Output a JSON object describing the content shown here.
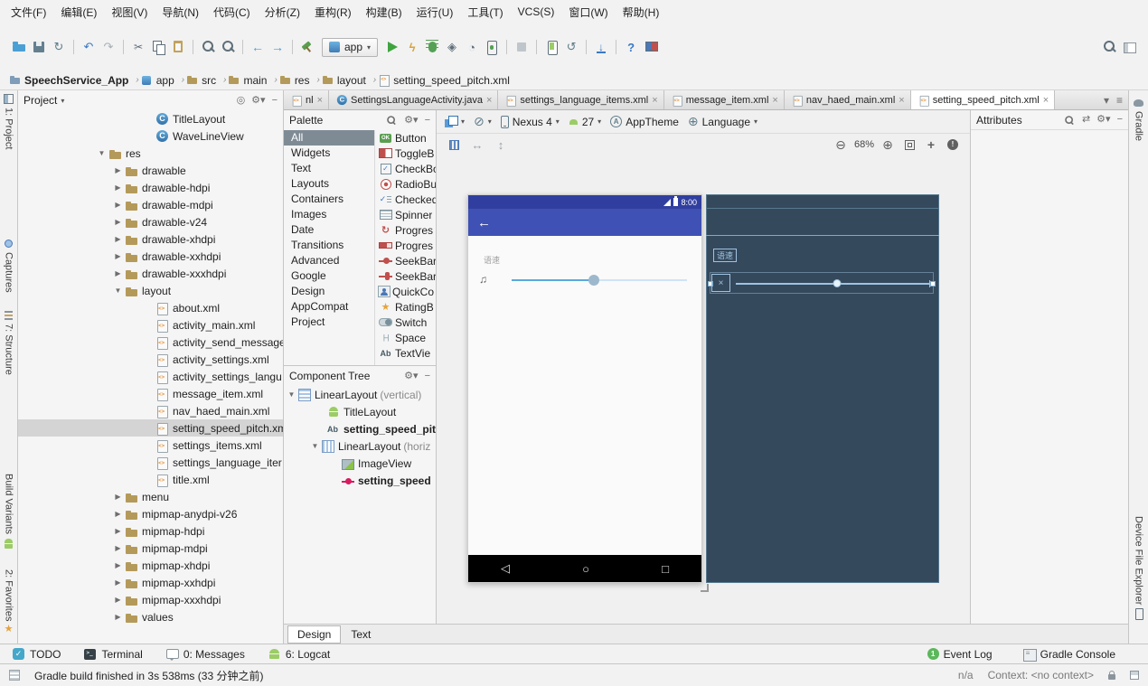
{
  "menu": {
    "items": [
      {
        "label": "文件(F)",
        "name": "menu-file"
      },
      {
        "label": "编辑(E)",
        "name": "menu-edit"
      },
      {
        "label": "视图(V)",
        "name": "menu-view"
      },
      {
        "label": "导航(N)",
        "name": "menu-navigate"
      },
      {
        "label": "代码(C)",
        "name": "menu-code"
      },
      {
        "label": "分析(Z)",
        "name": "menu-analyze"
      },
      {
        "label": "重构(R)",
        "name": "menu-refactor"
      },
      {
        "label": "构建(B)",
        "name": "menu-build"
      },
      {
        "label": "运行(U)",
        "name": "menu-run"
      },
      {
        "label": "工具(T)",
        "name": "menu-tools"
      },
      {
        "label": "VCS(S)",
        "name": "menu-vcs"
      },
      {
        "label": "窗口(W)",
        "name": "menu-window"
      },
      {
        "label": "帮助(H)",
        "name": "menu-help"
      }
    ]
  },
  "toolbar": {
    "run_config": "app",
    "icons_left": [
      {
        "name": "open"
      },
      {
        "name": "save"
      },
      {
        "name": "sync"
      },
      {
        "name": "sep"
      },
      {
        "name": "undo"
      },
      {
        "name": "redo"
      },
      {
        "name": "sep"
      },
      {
        "name": "cut"
      },
      {
        "name": "copy"
      },
      {
        "name": "paste"
      },
      {
        "name": "sep"
      },
      {
        "name": "find"
      },
      {
        "name": "replace"
      },
      {
        "name": "sep"
      },
      {
        "name": "nav-back"
      },
      {
        "name": "nav-forward"
      },
      {
        "name": "sep"
      },
      {
        "name": "build"
      }
    ],
    "icons_right": [
      {
        "name": "run"
      },
      {
        "name": "apply-changes"
      },
      {
        "name": "debug"
      },
      {
        "name": "coverage"
      },
      {
        "name": "profiler"
      },
      {
        "name": "attach-debugger"
      },
      {
        "name": "sep"
      },
      {
        "name": "stop"
      },
      {
        "name": "sep"
      },
      {
        "name": "avd-manager"
      },
      {
        "name": "gradle-sync"
      },
      {
        "name": "sep"
      },
      {
        "name": "sdk-manager"
      },
      {
        "name": "sep"
      },
      {
        "name": "help"
      },
      {
        "name": "monitor"
      }
    ],
    "icons_far": [
      {
        "name": "search-everywhere"
      },
      {
        "name": "panels"
      }
    ]
  },
  "breadcrumbs": [
    {
      "label": "SpeechService_App",
      "icon": "folder-root",
      "bold": "bold"
    },
    {
      "label": "app",
      "icon": "module"
    },
    {
      "label": "src",
      "icon": "folder"
    },
    {
      "label": "main",
      "icon": "folder"
    },
    {
      "label": "res",
      "icon": "folder"
    },
    {
      "label": "layout",
      "icon": "folder"
    },
    {
      "label": "setting_speed_pitch.xml",
      "icon": "xml"
    }
  ],
  "left_stripe": {
    "top": [
      {
        "label": "1: Project",
        "icon": "project-tool",
        "name": "toolwindow-project"
      },
      {
        "label": "Captures",
        "icon": "captures-tool",
        "name": "toolwindow-captures"
      },
      {
        "label": "7: Structure",
        "icon": "structure-tool",
        "name": "toolwindow-structure"
      }
    ],
    "bottom": [
      {
        "label": "Build Variants",
        "icon": "build-variants-tool",
        "name": "toolwindow-build-variants"
      },
      {
        "label": "2: Favorites",
        "icon": "favorites-tool",
        "name": "toolwindow-favorites"
      }
    ]
  },
  "right_stripe": {
    "top": [
      {
        "label": "Gradle",
        "icon": "gradle-tool",
        "name": "toolwindow-gradle"
      }
    ],
    "bottom": [
      {
        "label": "Device File Explorer",
        "icon": "device-explorer-tool",
        "name": "toolwindow-device-file-explorer"
      }
    ]
  },
  "project_panel": {
    "title": "Project",
    "tree": [
      {
        "label": "TitleLayout",
        "icon": "class",
        "indent": 138
      },
      {
        "label": "WaveLineView",
        "icon": "class",
        "indent": 138
      },
      {
        "label": "res",
        "icon": "folder",
        "indent": 86,
        "expander": "expanded"
      },
      {
        "label": "drawable",
        "icon": "folder",
        "indent": 104,
        "expander": "collapsed"
      },
      {
        "label": "drawable-hdpi",
        "icon": "folder",
        "indent": 104,
        "expander": "collapsed"
      },
      {
        "label": "drawable-mdpi",
        "icon": "folder",
        "indent": 104,
        "expander": "collapsed"
      },
      {
        "label": "drawable-v24",
        "icon": "folder",
        "indent": 104,
        "expander": "collapsed"
      },
      {
        "label": "drawable-xhdpi",
        "icon": "folder",
        "indent": 104,
        "expander": "collapsed"
      },
      {
        "label": "drawable-xxhdpi",
        "icon": "folder",
        "indent": 104,
        "expander": "collapsed"
      },
      {
        "label": "drawable-xxxhdpi",
        "icon": "folder",
        "indent": 104,
        "expander": "collapsed"
      },
      {
        "label": "layout",
        "icon": "folder",
        "indent": 104,
        "expander": "expanded"
      },
      {
        "label": "about.xml",
        "icon": "xml",
        "indent": 138
      },
      {
        "label": "activity_main.xml",
        "icon": "xml",
        "indent": 138
      },
      {
        "label": "activity_send_message",
        "icon": "xml",
        "indent": 138
      },
      {
        "label": "activity_settings.xml",
        "icon": "xml",
        "indent": 138
      },
      {
        "label": "activity_settings_langu",
        "icon": "xml",
        "indent": 138
      },
      {
        "label": "message_item.xml",
        "icon": "xml",
        "indent": 138
      },
      {
        "label": "nav_haed_main.xml",
        "icon": "xml",
        "indent": 138
      },
      {
        "label": "setting_speed_pitch.xml",
        "icon": "xml",
        "indent": 138,
        "state": "selected"
      },
      {
        "label": "settings_items.xml",
        "icon": "xml",
        "indent": 138
      },
      {
        "label": "settings_language_iter",
        "icon": "xml",
        "indent": 138
      },
      {
        "label": "title.xml",
        "icon": "xml",
        "indent": 138
      },
      {
        "label": "menu",
        "icon": "folder",
        "indent": 104,
        "expander": "collapsed"
      },
      {
        "label": "mipmap-anydpi-v26",
        "icon": "folder",
        "indent": 104,
        "expander": "collapsed"
      },
      {
        "label": "mipmap-hdpi",
        "icon": "folder",
        "indent": 104,
        "expander": "collapsed"
      },
      {
        "label": "mipmap-mdpi",
        "icon": "folder",
        "indent": 104,
        "expander": "collapsed"
      },
      {
        "label": "mipmap-xhdpi",
        "icon": "folder",
        "indent": 104,
        "expander": "collapsed"
      },
      {
        "label": "mipmap-xxhdpi",
        "icon": "folder",
        "indent": 104,
        "expander": "collapsed"
      },
      {
        "label": "mipmap-xxxhdpi",
        "icon": "folder",
        "indent": 104,
        "expander": "collapsed"
      },
      {
        "label": "values",
        "icon": "folder",
        "indent": 104,
        "expander": "collapsed"
      }
    ]
  },
  "editor_tabs": [
    {
      "label": "nl",
      "icon": "xml"
    },
    {
      "label": "SettingsLanguageActivity.java",
      "icon": "class"
    },
    {
      "label": "settings_language_items.xml",
      "icon": "xml"
    },
    {
      "label": "message_item.xml",
      "icon": "xml"
    },
    {
      "label": "nav_haed_main.xml",
      "icon": "xml"
    },
    {
      "label": "setting_speed_pitch.xml",
      "icon": "xml",
      "state": "active"
    }
  ],
  "palette": {
    "title": "Palette",
    "categories": [
      {
        "label": "All",
        "state": "selected"
      },
      {
        "label": "Widgets"
      },
      {
        "label": "Text"
      },
      {
        "label": "Layouts"
      },
      {
        "label": "Containers"
      },
      {
        "label": "Images"
      },
      {
        "label": "Date"
      },
      {
        "label": "Transitions"
      },
      {
        "label": "Advanced"
      },
      {
        "label": "Google"
      },
      {
        "label": "Design"
      },
      {
        "label": "AppCompat"
      },
      {
        "label": "Project"
      }
    ],
    "components": [
      {
        "label": "Button",
        "icon": "button",
        "name": "widget-button"
      },
      {
        "label": "ToggleB",
        "icon": "toggle",
        "name": "widget-togglebutton"
      },
      {
        "label": "CheckBo",
        "icon": "checkbox",
        "name": "widget-checkbox"
      },
      {
        "label": "RadioBu",
        "icon": "radio",
        "name": "widget-radiobutton"
      },
      {
        "label": "Checked",
        "icon": "checktext",
        "name": "widget-checkedtextview"
      },
      {
        "label": "Spinner",
        "icon": "spinner",
        "name": "widget-spinner"
      },
      {
        "label": "Progres",
        "icon": "progress-circ",
        "name": "widget-progressbar"
      },
      {
        "label": "Progres",
        "icon": "progress-horiz",
        "name": "widget-progressbar-horizontal"
      },
      {
        "label": "SeekBar",
        "icon": "seekbar",
        "name": "widget-seekbar"
      },
      {
        "label": "SeekBar",
        "icon": "seekbar-discrete",
        "name": "widget-seekbar-discrete"
      },
      {
        "label": "QuickCo",
        "icon": "quickcontact",
        "name": "widget-quickcontactbadge"
      },
      {
        "label": "RatingB",
        "icon": "rating",
        "name": "widget-ratingbar"
      },
      {
        "label": "Switch",
        "icon": "switch",
        "name": "widget-switch"
      },
      {
        "label": "Space",
        "icon": "space",
        "name": "widget-space"
      },
      {
        "label": "TextVie",
        "icon": "textview",
        "name": "widget-textview"
      }
    ]
  },
  "component_tree": {
    "title": "Component Tree",
    "items": [
      {
        "label": "LinearLayout",
        "suffix": "(vertical)",
        "icon": "linear-v",
        "expander": "expanded",
        "indent": 2,
        "name": "comptree-linearlayout-vertical"
      },
      {
        "label": "TitleLayout",
        "icon": "android",
        "indent": 34,
        "name": "comptree-titlelayout"
      },
      {
        "label": "setting_speed_pit",
        "icon": "textview",
        "indent": 34,
        "bold": "bold",
        "name": "comptree-setting-speed-pit"
      },
      {
        "label": "LinearLayout",
        "suffix": "(horiz",
        "icon": "linear-h",
        "expander": "expanded",
        "indent": 28,
        "name": "comptree-linearlayout-horizontal"
      },
      {
        "label": "ImageView",
        "icon": "imageview",
        "indent": 50,
        "name": "comptree-imageview"
      },
      {
        "label": "setting_speed",
        "icon": "seekbar-pink",
        "indent": 50,
        "bold": "bold",
        "name": "comptree-setting-speed"
      }
    ]
  },
  "design_toolbar": {
    "device": "Nexus 4",
    "api": "27",
    "theme": "AppTheme",
    "locale": "Language",
    "zoom": "68%"
  },
  "phone": {
    "time": "8:00",
    "speed_label": "语速",
    "seek_percent": 47
  },
  "blueprint": {
    "speed_label": "语速",
    "seek_percent": 52
  },
  "attributes_panel": {
    "title": "Attributes"
  },
  "editor_mode_tabs": [
    {
      "label": "Design",
      "state": "active",
      "name": "mode-tab-design"
    },
    {
      "label": "Text",
      "name": "mode-tab-text"
    }
  ],
  "bottom_bar": {
    "left": [
      {
        "label": "TODO",
        "icon": "todo",
        "name": "toolwindow-todo"
      },
      {
        "label": "Terminal",
        "icon": "terminal",
        "name": "toolwindow-terminal"
      },
      {
        "label": "0: Messages",
        "icon": "messages",
        "name": "toolwindow-messages"
      },
      {
        "label": "6: Logcat",
        "icon": "logcat",
        "name": "toolwindow-logcat"
      }
    ],
    "right": [
      {
        "label": "Event Log",
        "badge": "1",
        "name": "toolwindow-event-log"
      },
      {
        "label": "Gradle Console",
        "icon": "console",
        "name": "toolwindow-gradle-console"
      }
    ]
  },
  "status_bar": {
    "message": "Gradle build finished in 3s 538ms (33 分钟之前)",
    "na": "n/a",
    "context": "Context: <no context>"
  }
}
